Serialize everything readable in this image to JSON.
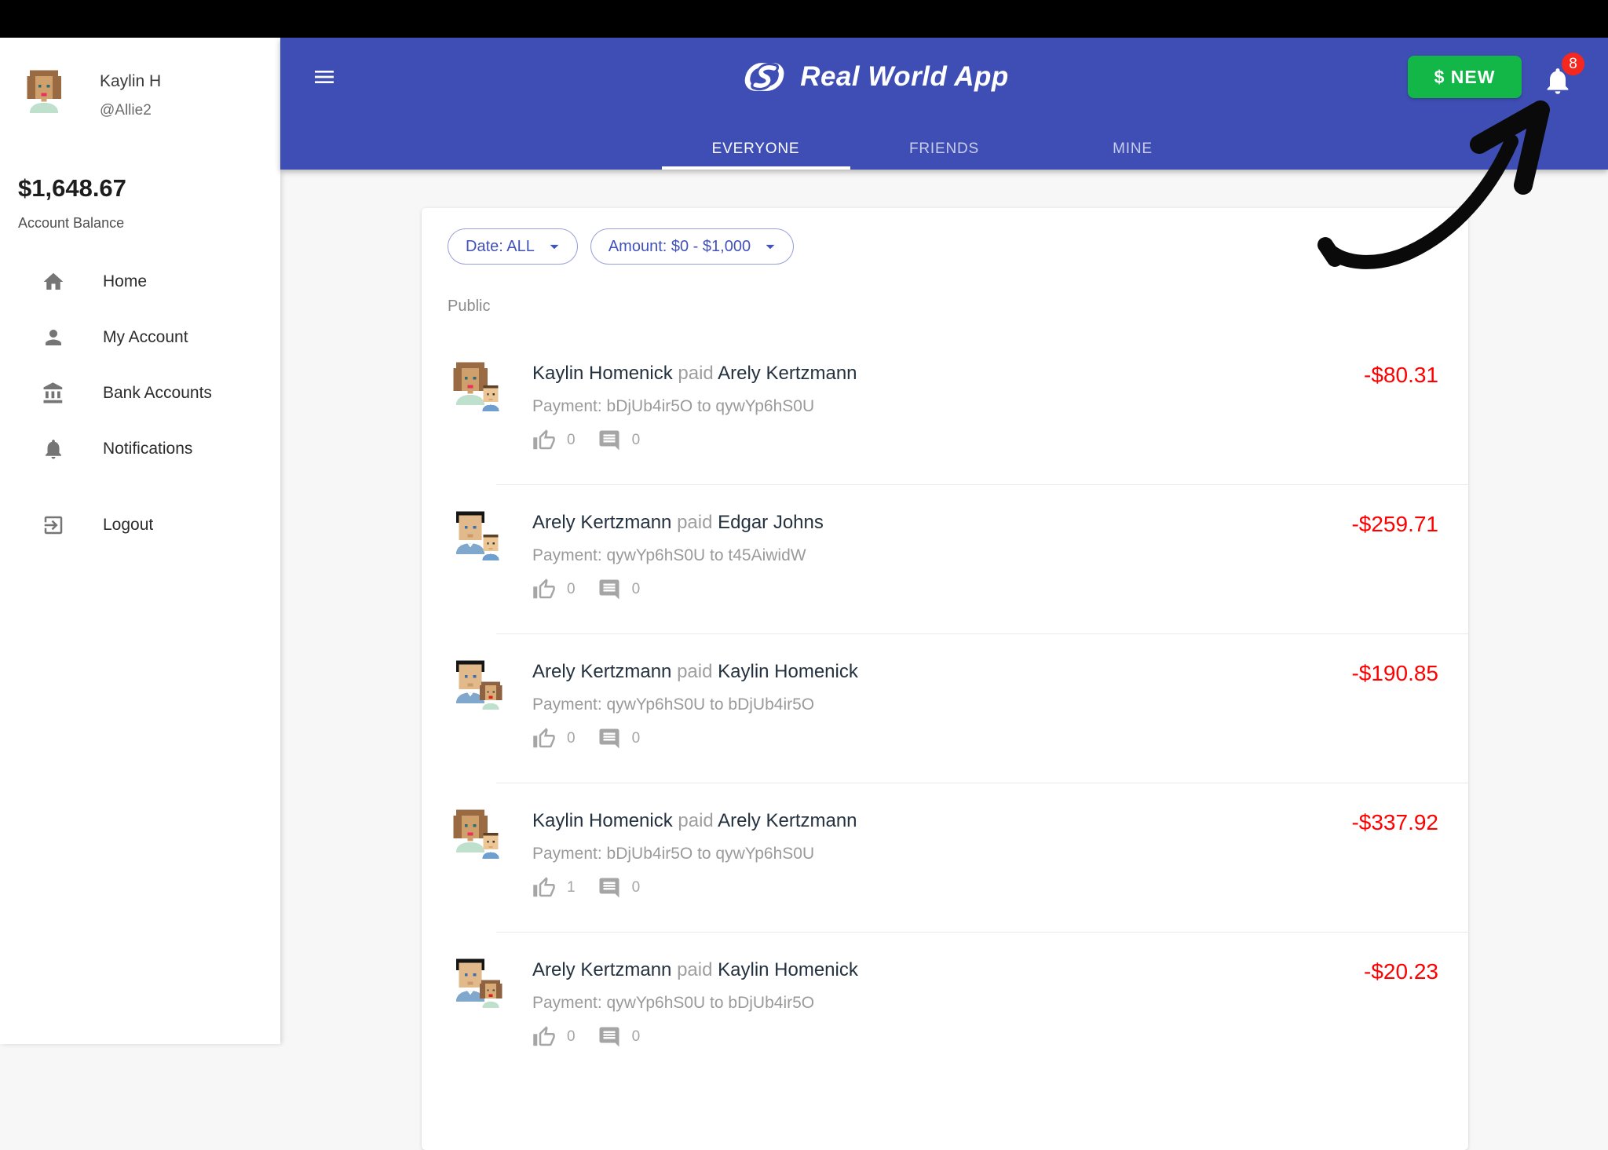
{
  "user": {
    "name": "Kaylin H",
    "handle": "@Allie2",
    "avatar": "woman"
  },
  "balance": {
    "amount": "$1,648.67",
    "label": "Account Balance"
  },
  "sidebar": {
    "items": [
      {
        "icon": "home-icon",
        "label": "Home"
      },
      {
        "icon": "person-icon",
        "label": "My Account"
      },
      {
        "icon": "bank-icon",
        "label": "Bank Accounts"
      },
      {
        "icon": "bell-icon",
        "label": "Notifications"
      }
    ],
    "logout": {
      "icon": "logout-icon",
      "label": "Logout"
    }
  },
  "header": {
    "title": "Real World App",
    "new_button": "$ NEW",
    "notification_count": "8",
    "tabs": [
      {
        "label": "EVERYONE",
        "active": true
      },
      {
        "label": "FRIENDS",
        "active": false
      },
      {
        "label": "MINE",
        "active": false
      }
    ]
  },
  "filters": {
    "date_label": "Date: ALL",
    "amount_label": "Amount: $0 - $1,000"
  },
  "feed": {
    "section_label": "Public",
    "transactions": [
      {
        "sender": "Kaylin Homenick",
        "action": "paid",
        "receiver": "Arely Kertzmann",
        "description": "Payment: bDjUb4ir5O to qywYp6hS0U",
        "likes": "0",
        "comments": "0",
        "amount": "-$80.31",
        "avatar_main": "woman",
        "avatar_small": "boy"
      },
      {
        "sender": "Arely Kertzmann",
        "action": "paid",
        "receiver": "Edgar Johns",
        "description": "Payment: qywYp6hS0U to t45AiwidW",
        "likes": "0",
        "comments": "0",
        "amount": "-$259.71",
        "avatar_main": "man",
        "avatar_small": "boy"
      },
      {
        "sender": "Arely Kertzmann",
        "action": "paid",
        "receiver": "Kaylin Homenick",
        "description": "Payment: qywYp6hS0U to bDjUb4ir5O",
        "likes": "0",
        "comments": "0",
        "amount": "-$190.85",
        "avatar_main": "man",
        "avatar_small": "girl"
      },
      {
        "sender": "Kaylin Homenick",
        "action": "paid",
        "receiver": "Arely Kertzmann",
        "description": "Payment: bDjUb4ir5O to qywYp6hS0U",
        "likes": "1",
        "comments": "0",
        "amount": "-$337.92",
        "avatar_main": "woman",
        "avatar_small": "boy"
      },
      {
        "sender": "Arely Kertzmann",
        "action": "paid",
        "receiver": "Kaylin Homenick",
        "description": "Payment: qywYp6hS0U to bDjUb4ir5O",
        "likes": "0",
        "comments": "0",
        "amount": "-$20.23",
        "avatar_main": "man",
        "avatar_small": "girl"
      }
    ]
  },
  "colors": {
    "header_blue": "#3f4eb5",
    "accent_green": "#12b747",
    "badge_red": "#f4281e",
    "amount_red": "#ff0000",
    "filter_indigo": "#4152bb"
  }
}
